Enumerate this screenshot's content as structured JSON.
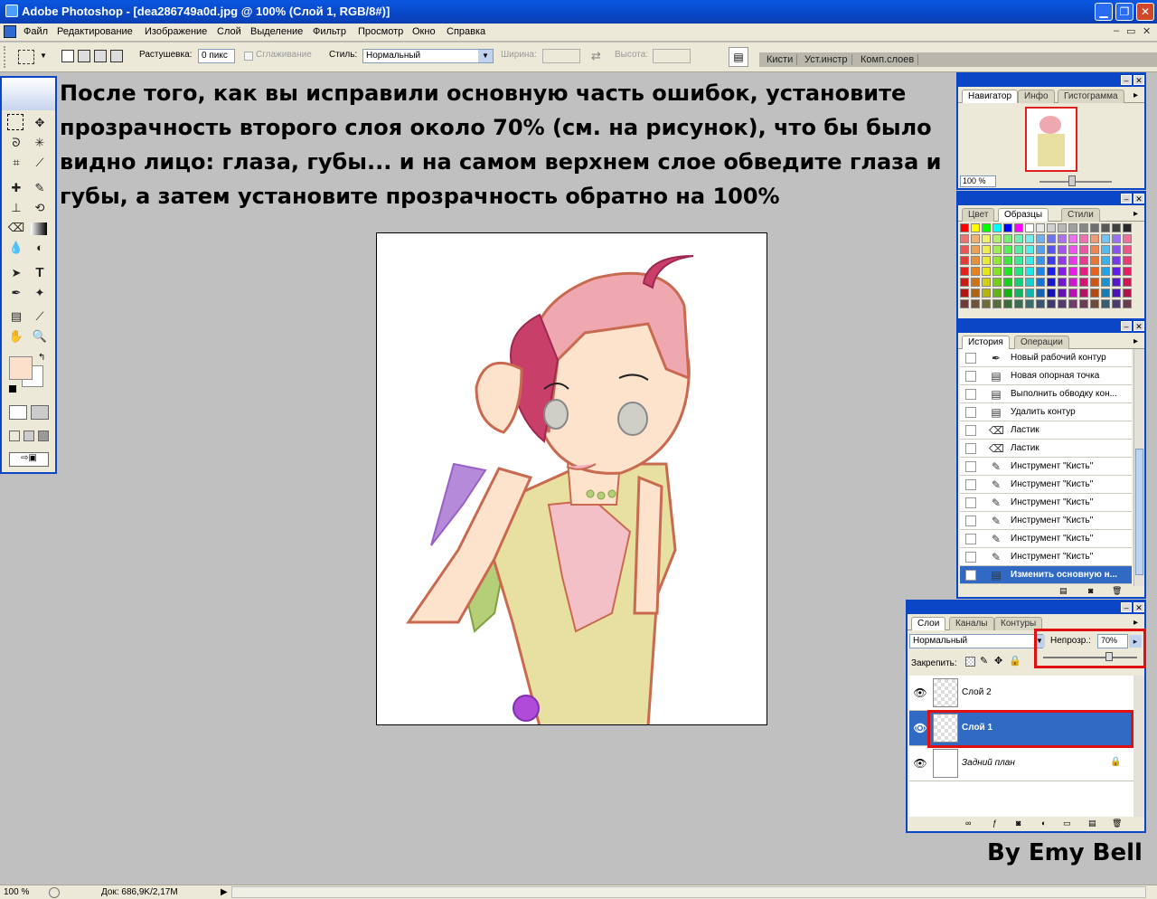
{
  "window": {
    "title": "Adobe Photoshop - [dea286749a0d.jpg @ 100% (Слой 1, RGB/8#)]",
    "min": "▁",
    "max": "❐",
    "close": "✕"
  },
  "menu": {
    "items": [
      "Файл",
      "Редактирование",
      "Изображение",
      "Слой",
      "Выделение",
      "Фильтр",
      "Просмотр",
      "Окно",
      "Справка"
    ],
    "right": [
      "–",
      "▭",
      "✕"
    ]
  },
  "options": {
    "feather_label": "Растушевка:",
    "feather_value": "0 пикс",
    "antialias_label": "Сглаживание",
    "style_label": "Стиль:",
    "style_value": "Нормальный",
    "width_label": "Ширина:",
    "height_label": "Высота:"
  },
  "palette_well": [
    "Кисти",
    "Уст.инстр",
    "Комп.слоев"
  ],
  "instructions": "После того, как вы исправили основную часть ошибок, установите прозрачность второго слоя около 70% (см. на рисунок), что бы было видно лицо: глаза, губы... и на самом верхнем слое обведите глаза и губы, а затем установите прозрачность обратно на 100%",
  "byline": "By Emy Bell",
  "navigator": {
    "tabs": [
      "Навигатор",
      "Инфо",
      "Гистограмма"
    ],
    "zoom": "100 %"
  },
  "swatches": {
    "tabs": [
      "Цвет",
      "Образцы",
      "Стили"
    ]
  },
  "history": {
    "tabs": [
      "История",
      "Операции"
    ],
    "items": [
      {
        "icon": "pen",
        "label": "Новый рабочий контур"
      },
      {
        "icon": "doc",
        "label": "Новая опорная точка"
      },
      {
        "icon": "doc",
        "label": "Выполнить обводку кон..."
      },
      {
        "icon": "doc",
        "label": "Удалить контур"
      },
      {
        "icon": "eraser",
        "label": "Ластик"
      },
      {
        "icon": "eraser",
        "label": "Ластик"
      },
      {
        "icon": "brush",
        "label": "Инструмент \"Кисть\""
      },
      {
        "icon": "brush",
        "label": "Инструмент \"Кисть\""
      },
      {
        "icon": "brush",
        "label": "Инструмент \"Кисть\""
      },
      {
        "icon": "brush",
        "label": "Инструмент \"Кисть\""
      },
      {
        "icon": "brush",
        "label": "Инструмент \"Кисть\""
      },
      {
        "icon": "brush",
        "label": "Инструмент \"Кисть\""
      },
      {
        "icon": "doc",
        "label": "Изменить основную н..."
      }
    ],
    "selected_index": 12
  },
  "layers": {
    "tabs": [
      "Слои",
      "Каналы",
      "Контуры"
    ],
    "blend_mode": "Нормальный",
    "opacity_label": "Непрозр.:",
    "opacity_value": "70%",
    "opacity": 0.7,
    "lock_label": "Закрепить:",
    "items": [
      {
        "name": "Слой 2",
        "selected": false
      },
      {
        "name": "Слой 1",
        "selected": true
      },
      {
        "name": "Задний план",
        "selected": false,
        "locked": true
      }
    ]
  },
  "status": {
    "zoom": "100 %",
    "doc": "Док: 686,9K/2,17M"
  },
  "colors": {
    "xp_blue": "#0a46c6",
    "panel_bg": "#ece9d8",
    "selection": "#316ac5",
    "highlight_red": "#e01010",
    "foreground_swatch": "#fde0cc",
    "background_swatch": "#ffffff"
  }
}
